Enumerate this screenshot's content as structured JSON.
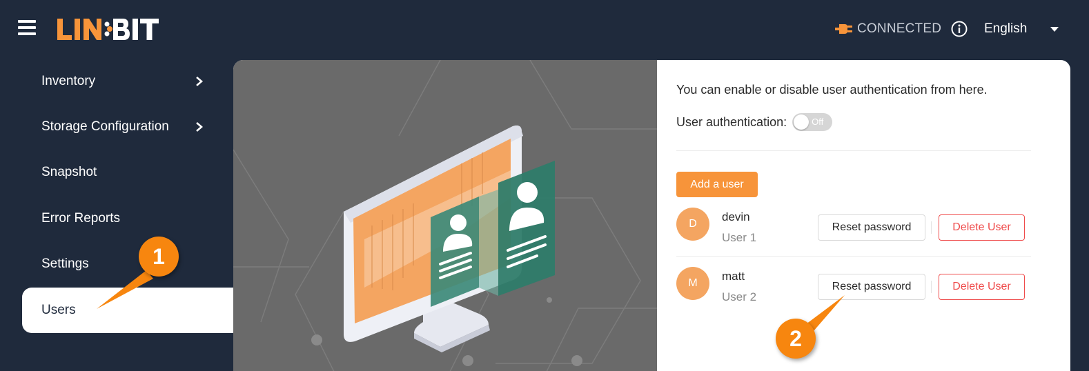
{
  "header": {
    "logo_text": "LINBIT",
    "connection_status": "CONNECTED",
    "language": "English"
  },
  "sidebar": {
    "items": [
      {
        "label": "Inventory",
        "has_submenu": true
      },
      {
        "label": "Storage Configuration",
        "has_submenu": true
      },
      {
        "label": "Snapshot",
        "has_submenu": false
      },
      {
        "label": "Error Reports",
        "has_submenu": false
      },
      {
        "label": "Settings",
        "has_submenu": false
      },
      {
        "label": "Users",
        "has_submenu": false,
        "active": true
      }
    ]
  },
  "users_panel": {
    "intro": "You can enable or disable user authentication from here.",
    "auth_label": "User authentication:",
    "auth_toggle_state": "Off",
    "add_user_label": "Add a user",
    "users": [
      {
        "initial": "D",
        "name": "devin",
        "role": "User 1",
        "reset_label": "Reset password",
        "delete_label": "Delete User"
      },
      {
        "initial": "M",
        "name": "matt",
        "role": "User 2",
        "reset_label": "Reset password",
        "delete_label": "Delete User"
      }
    ]
  },
  "callouts": {
    "first": "1",
    "second": "2"
  },
  "colors": {
    "background": "#1f2a3c",
    "accent": "#f7943a",
    "danger": "#ef4b4b",
    "illustration_bg": "#6a6a6a"
  }
}
